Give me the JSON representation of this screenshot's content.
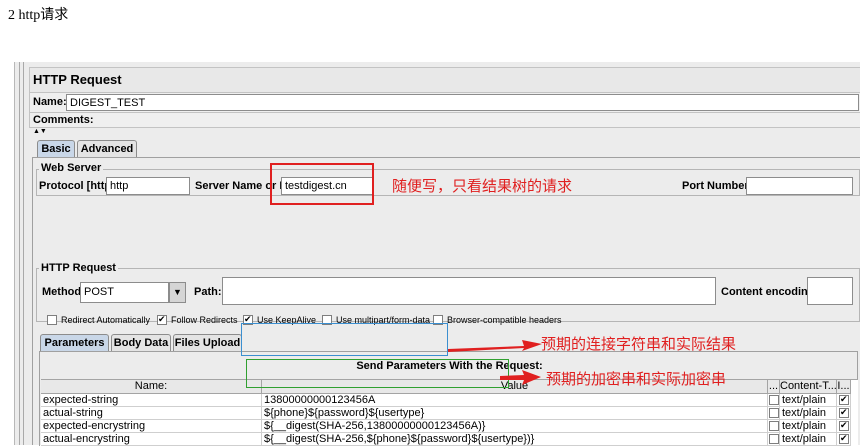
{
  "doc": {
    "heading": "2 http请求"
  },
  "panel": {
    "title": "HTTP Request",
    "name_label": "Name:",
    "name_value": "DIGEST_TEST",
    "comments_label": "Comments:"
  },
  "tabs": {
    "basic": "Basic",
    "advanced": "Advanced"
  },
  "web_server": {
    "legend": "Web Server",
    "protocol_label": "Protocol [http]:",
    "protocol_value": "http",
    "server_label": "Server Name or IP:",
    "server_value": "testdigest.cn",
    "port_label": "Port Number:",
    "port_value": ""
  },
  "http_request": {
    "legend": "HTTP Request",
    "method_label": "Method:",
    "method_value": "POST",
    "path_label": "Path:",
    "path_value": "",
    "encoding_label": "Content encoding:",
    "encoding_value": ""
  },
  "options": [
    {
      "label": "Redirect Automatically",
      "checked": false
    },
    {
      "label": "Follow Redirects",
      "checked": true
    },
    {
      "label": "Use KeepAlive",
      "checked": true
    },
    {
      "label": "Use multipart/form-data",
      "checked": false
    },
    {
      "label": "Browser-compatible headers",
      "checked": false
    }
  ],
  "subtabs": {
    "parameters": "Parameters",
    "body_data": "Body Data",
    "files_upload": "Files Upload"
  },
  "params_table": {
    "title": "Send Parameters With the Request:",
    "headers": {
      "name": "Name:",
      "value": "Value",
      "dots": "...",
      "content_type": "Content-T...",
      "include": "I..."
    },
    "rows": [
      {
        "name": "expected-string",
        "value": "13800000000123456A",
        "content_type": "text/plain",
        "include": true
      },
      {
        "name": "actual-string",
        "value": "${phone}${password}${usertype}",
        "content_type": "text/plain",
        "include": true
      },
      {
        "name": "expected-encrystring",
        "value": "${__digest(SHA-256,13800000000123456A)}",
        "content_type": "text/plain",
        "include": true
      },
      {
        "name": "actual-encrystring",
        "value": "${__digest(SHA-256,${phone}${password}${usertype})}",
        "content_type": "text/plain",
        "include": true
      }
    ]
  },
  "annotations": {
    "note1": "随便写，只看结果树的请求",
    "note2": "预期的连接字符串和实际结果",
    "note3": "预期的加密串和实际加密串"
  },
  "colors": {
    "annotation_red": "#e02020",
    "highlight_red": "#e02020",
    "highlight_blue": "#3b8fd0",
    "highlight_green": "#30a030"
  }
}
